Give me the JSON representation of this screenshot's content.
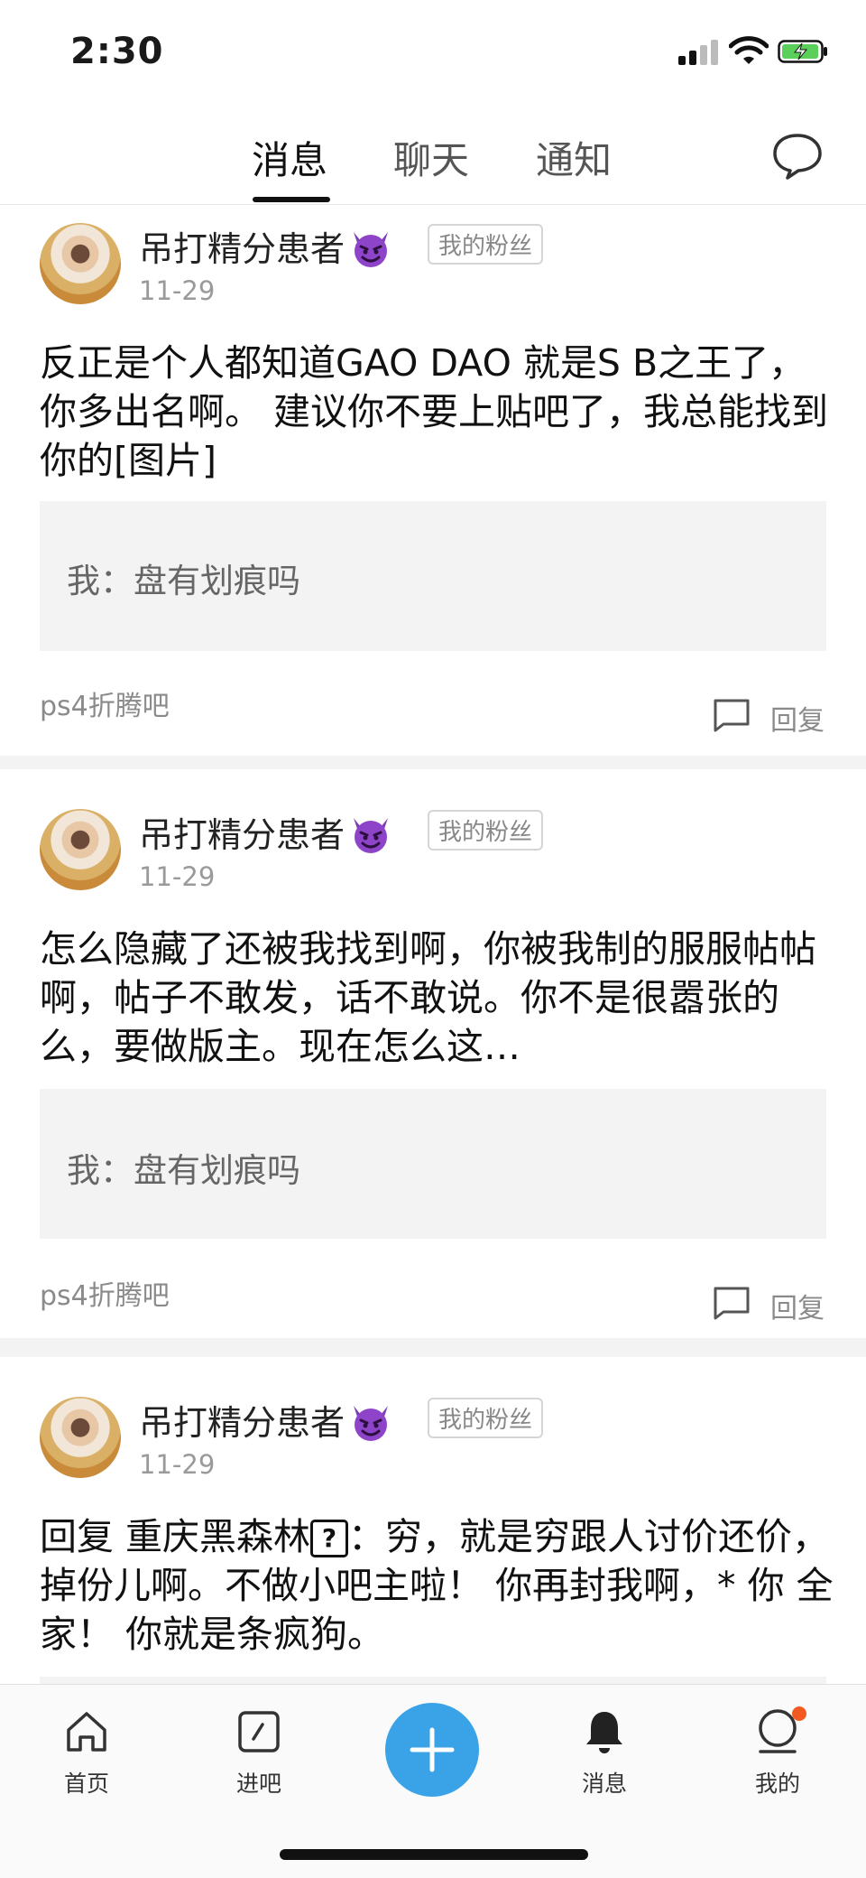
{
  "status_bar": {
    "time": "2:30"
  },
  "header": {
    "tabs": [
      {
        "label": "消息",
        "active": true
      },
      {
        "label": "聊天",
        "active": false
      },
      {
        "label": "通知",
        "active": false
      }
    ],
    "chat_icon": "speech-bubble-icon"
  },
  "posts": [
    {
      "username": "吊打精分患者",
      "badge": "我的粉丝",
      "date": "11-29",
      "body": "反正是个人都知道GAO DAO 就是S B之王了，你多出名啊。 建议你不要上贴吧了，我总能找到你的[图片]",
      "quote": "我：盘有划痕吗",
      "forum": "ps4折腾吧",
      "reply_label": "回复"
    },
    {
      "username": "吊打精分患者",
      "badge": "我的粉丝",
      "date": "11-29",
      "body": "怎么隐藏了还被我找到啊，你被我制的服服帖帖啊，帖子不敢发，话不敢说。你不是很嚣张的么，要做版主。现在怎么这…",
      "quote": "我：盘有划痕吗",
      "forum": "ps4折腾吧",
      "reply_label": "回复"
    },
    {
      "username": "吊打精分患者",
      "badge": "我的粉丝",
      "date": "11-29",
      "body_prefix": "回复 重庆黑森林",
      "body_box": "?",
      "body_suffix": "：穷，就是穷跟人讨价还价，掉份儿啊。不做小吧主啦！ 你再封我啊，* 你 全家！ 你就是条疯狗。"
    }
  ],
  "bottom_nav": {
    "items": [
      {
        "label": "首页",
        "icon": "home-icon"
      },
      {
        "label": "进吧",
        "icon": "enter-forum-icon"
      },
      {
        "label": "消息",
        "icon": "bell-icon"
      },
      {
        "label": "我的",
        "icon": "profile-icon"
      }
    ],
    "fab_icon": "plus-icon",
    "accent": "#3aa3e8",
    "notification_dot": "#f25a22"
  }
}
